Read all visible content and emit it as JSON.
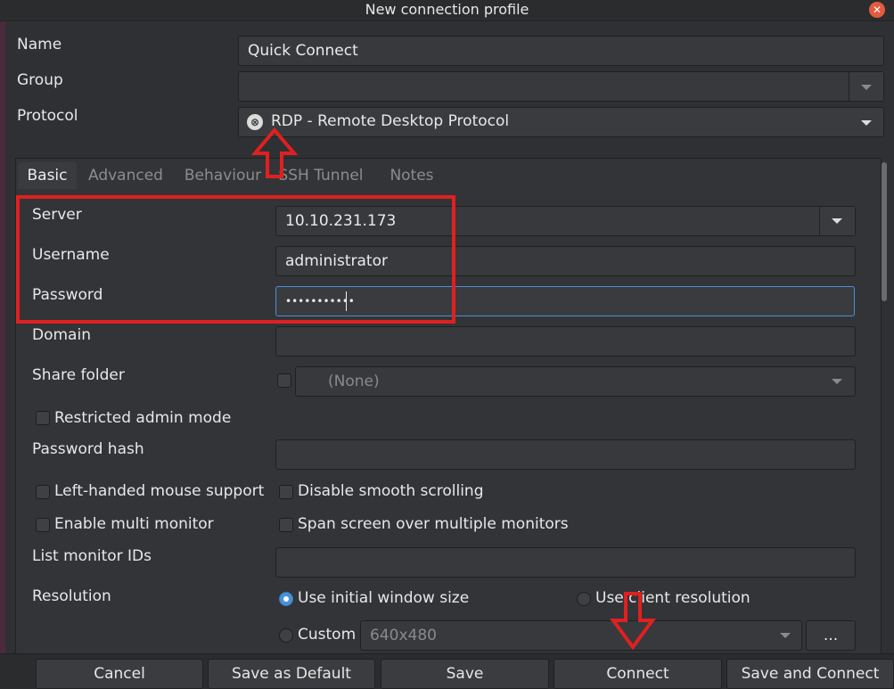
{
  "window": {
    "title": "New connection profile"
  },
  "fields": {
    "name": {
      "label": "Name",
      "value": "Quick Connect"
    },
    "group": {
      "label": "Group",
      "value": ""
    },
    "protocol": {
      "label": "Protocol",
      "value": "RDP - Remote Desktop Protocol"
    }
  },
  "tabs": [
    "Basic",
    "Advanced",
    "Behaviour",
    "SSH Tunnel",
    "Notes"
  ],
  "basic": {
    "server": {
      "label": "Server",
      "value": "10.10.231.173"
    },
    "username": {
      "label": "Username",
      "value": "administrator"
    },
    "password": {
      "label": "Password",
      "value": "•••••••••••"
    },
    "domain": {
      "label": "Domain",
      "value": ""
    },
    "share_folder": {
      "label": "Share folder",
      "value": "(None)"
    },
    "restricted_admin": "Restricted admin mode",
    "password_hash": {
      "label": "Password hash",
      "value": ""
    },
    "left_handed": "Left-handed mouse support",
    "disable_smooth": "Disable smooth scrolling",
    "multi_monitor": "Enable multi monitor",
    "span_screen": "Span screen over multiple monitors",
    "monitor_ids": {
      "label": "List monitor IDs",
      "value": ""
    },
    "resolution": {
      "label": "Resolution",
      "initial": "Use initial window size",
      "client": "Use client resolution",
      "custom": "Custom",
      "custom_value": "640x480",
      "more": "..."
    }
  },
  "buttons": {
    "cancel": "Cancel",
    "save_default": "Save as Default",
    "save": "Save",
    "connect": "Connect",
    "save_connect": "Save and Connect"
  },
  "colors": {
    "accent": "#4a90d9",
    "annotation": "#e02020",
    "close": "#e35b3f"
  },
  "icons": {
    "close": "close-icon",
    "protocol": "rdp-protocol-icon",
    "dropdown": "chevron-down-icon",
    "annotation_up": "arrow-up-annotation",
    "annotation_down": "arrow-down-annotation"
  }
}
